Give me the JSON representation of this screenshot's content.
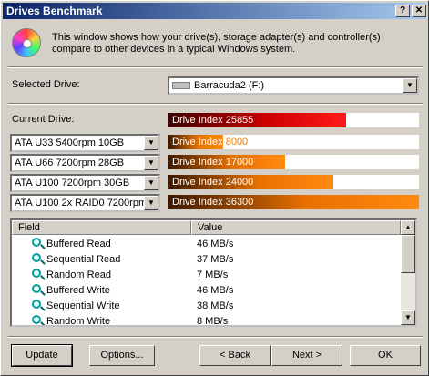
{
  "window": {
    "title": "Drives Benchmark",
    "help_label": "?",
    "close_label": "✕"
  },
  "intro": {
    "icon": "cd-disc-icon",
    "text": "This window shows how your drive(s), storage adapter(s) and controller(s) compare to other devices in a typical Windows system."
  },
  "selected_drive": {
    "label": "Selected Drive:",
    "value": "Barracuda2 (F:)"
  },
  "current_drive": {
    "label": "Current Drive:",
    "bar_label": "Drive Index",
    "value": "25855",
    "fraction": 0.711
  },
  "comparisons": [
    {
      "device": "ATA U33 5400rpm 10GB",
      "bar_label": "Drive Index",
      "value": "8000",
      "fraction": 0.22
    },
    {
      "device": "ATA U66 7200rpm 28GB",
      "bar_label": "Drive Index",
      "value": "17000",
      "fraction": 0.468
    },
    {
      "device": "ATA U100 7200rpm 30GB",
      "bar_label": "Drive Index",
      "value": "24000",
      "fraction": 0.66
    },
    {
      "device": "ATA U100 2x RAID0 7200rpm",
      "bar_label": "Drive Index",
      "value": "36300",
      "fraction": 1.0
    }
  ],
  "colors": {
    "current_fill": "#cc0000",
    "compare_fill": "#e87000"
  },
  "table": {
    "headers": [
      "Field",
      "Value"
    ],
    "rows": [
      {
        "field": "Buffered Read",
        "value": "46 MB/s"
      },
      {
        "field": "Sequential Read",
        "value": "37 MB/s"
      },
      {
        "field": "Random Read",
        "value": "7 MB/s"
      },
      {
        "field": "Buffered Write",
        "value": "46 MB/s"
      },
      {
        "field": "Sequential Write",
        "value": "38 MB/s"
      },
      {
        "field": "Random Write",
        "value": "8 MB/s"
      }
    ]
  },
  "buttons": {
    "update": "Update",
    "options": "Options...",
    "back": "< Back",
    "next": "Next >",
    "ok": "OK"
  }
}
